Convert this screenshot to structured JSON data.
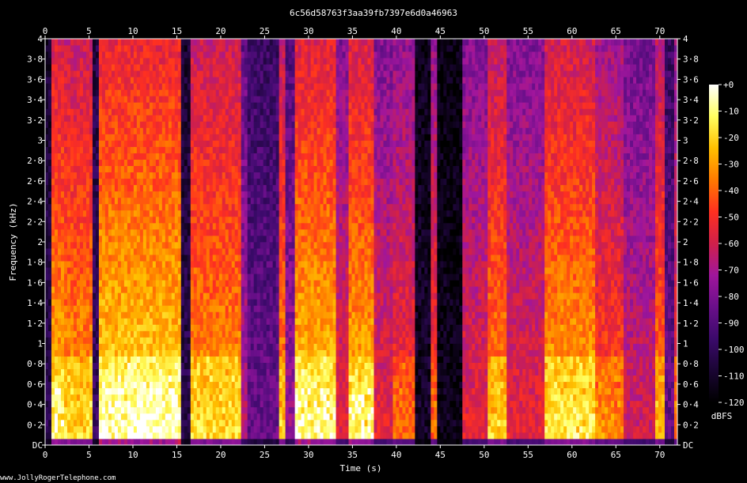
{
  "chart_data": {
    "type": "heatmap",
    "title": "6c56d58763f3aa39fb7397e6d0a46963",
    "xlabel": "Time (s)",
    "ylabel": "Frequency (kHz)",
    "xlim": [
      0,
      72
    ],
    "ylim": [
      0,
      4
    ],
    "x_ticks": [
      0,
      5,
      10,
      15,
      20,
      25,
      30,
      35,
      40,
      45,
      50,
      55,
      60,
      65,
      70
    ],
    "y_ticks": [
      "DC",
      "0·2",
      "0·4",
      "0·6",
      "0·8",
      "1",
      "1·2",
      "1·4",
      "1·6",
      "1·8",
      "2",
      "2·2",
      "2·4",
      "2·6",
      "2·8",
      "3",
      "3·2",
      "3·4",
      "3·6",
      "3·8",
      "4"
    ],
    "colorbar": {
      "label": "dBFS",
      "ticks": [
        "+0",
        "-10",
        "-20",
        "-30",
        "-40",
        "-50",
        "-60",
        "-70",
        "-80",
        "-90",
        "-100",
        "-110",
        "-120"
      ],
      "range": [
        -120,
        0
      ],
      "colors": [
        "#000000",
        "#1a0533",
        "#3b0a6b",
        "#6a0f8a",
        "#a0169c",
        "#d0204a",
        "#ff3020",
        "#ff7a00",
        "#ffc000",
        "#ffff60",
        "#ffffff"
      ]
    },
    "energy_segments": [
      {
        "start": 0.0,
        "end": 0.6,
        "level": 0.15
      },
      {
        "start": 0.6,
        "end": 2.0,
        "level": 0.82
      },
      {
        "start": 2.0,
        "end": 5.5,
        "level": 0.78
      },
      {
        "start": 5.5,
        "end": 6.0,
        "level": 0.2
      },
      {
        "start": 6.0,
        "end": 15.5,
        "level": 0.88
      },
      {
        "start": 15.5,
        "end": 16.5,
        "level": 0.15
      },
      {
        "start": 16.5,
        "end": 22.5,
        "level": 0.78
      },
      {
        "start": 22.5,
        "end": 23.2,
        "level": 0.45
      },
      {
        "start": 23.2,
        "end": 26.5,
        "level": 0.3
      },
      {
        "start": 26.5,
        "end": 27.2,
        "level": 0.75
      },
      {
        "start": 27.2,
        "end": 28.5,
        "level": 0.4
      },
      {
        "start": 28.5,
        "end": 33.0,
        "level": 0.85
      },
      {
        "start": 33.0,
        "end": 34.5,
        "level": 0.55
      },
      {
        "start": 34.5,
        "end": 37.5,
        "level": 0.82
      },
      {
        "start": 37.5,
        "end": 39.5,
        "level": 0.55
      },
      {
        "start": 39.5,
        "end": 42.0,
        "level": 0.6
      },
      {
        "start": 42.0,
        "end": 44.0,
        "level": 0.08
      },
      {
        "start": 44.0,
        "end": 44.8,
        "level": 0.62
      },
      {
        "start": 44.8,
        "end": 47.5,
        "level": 0.05
      },
      {
        "start": 47.5,
        "end": 50.5,
        "level": 0.55
      },
      {
        "start": 50.5,
        "end": 52.5,
        "level": 0.75
      },
      {
        "start": 52.5,
        "end": 57.0,
        "level": 0.55
      },
      {
        "start": 57.0,
        "end": 62.5,
        "level": 0.8
      },
      {
        "start": 62.5,
        "end": 66.0,
        "level": 0.65
      },
      {
        "start": 66.0,
        "end": 69.5,
        "level": 0.5
      },
      {
        "start": 69.5,
        "end": 70.6,
        "level": 0.72
      },
      {
        "start": 70.6,
        "end": 71.5,
        "level": 0.3
      },
      {
        "start": 71.5,
        "end": 72.0,
        "level": 0.6
      }
    ]
  },
  "footer": {
    "credit": "www.JollyRogerTelephone.com"
  }
}
